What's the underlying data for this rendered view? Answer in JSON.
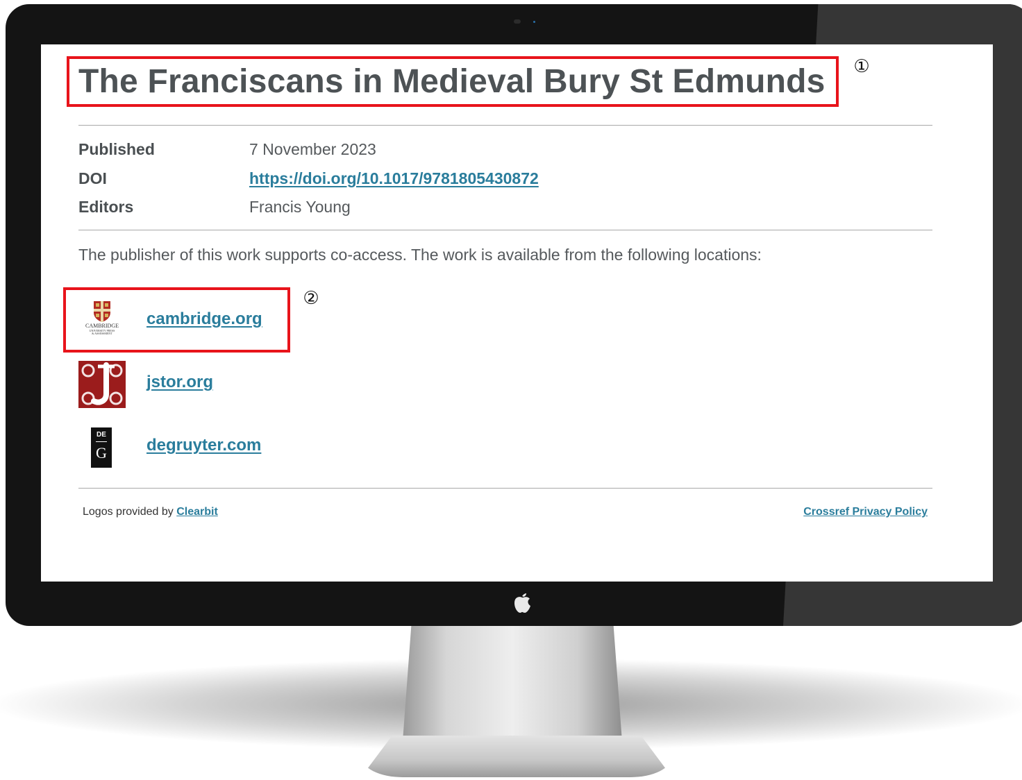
{
  "page": {
    "title": "The Franciscans in Medieval Bury St Edmunds",
    "metadata": [
      {
        "label": "Published",
        "value": "7 November 2023"
      },
      {
        "label": "DOI",
        "value": "https://doi.org/10.1017/9781805430872"
      },
      {
        "label": "Editors",
        "value": "Francis Young"
      }
    ],
    "coaccess_text": "The publisher of this work supports co-access. The work is available from the following locations:",
    "locations": [
      {
        "label": "cambridge.org",
        "logo": "cambridge-logo"
      },
      {
        "label": "jstor.org",
        "logo": "jstor-logo"
      },
      {
        "label": "degruyter.com",
        "logo": "degruyter-logo"
      }
    ],
    "cambridge_logo_text": [
      "CAMBRIDGE",
      "UNIVERSITY PRESS",
      "& ASSESSMENT"
    ],
    "degruyter_logo_text": [
      "DE",
      "G"
    ],
    "footer": {
      "logos_prefix": "Logos provided by",
      "logos_link": "Clearbit",
      "privacy_link": "Crossref Privacy Policy"
    }
  },
  "annotations": {
    "marker_1": "①",
    "marker_2": "②",
    "highlight_color": "#e8141b"
  },
  "colors": {
    "link": "#2a7d9c",
    "title": "#4d5255",
    "jstor_red": "#9b1c1c"
  }
}
